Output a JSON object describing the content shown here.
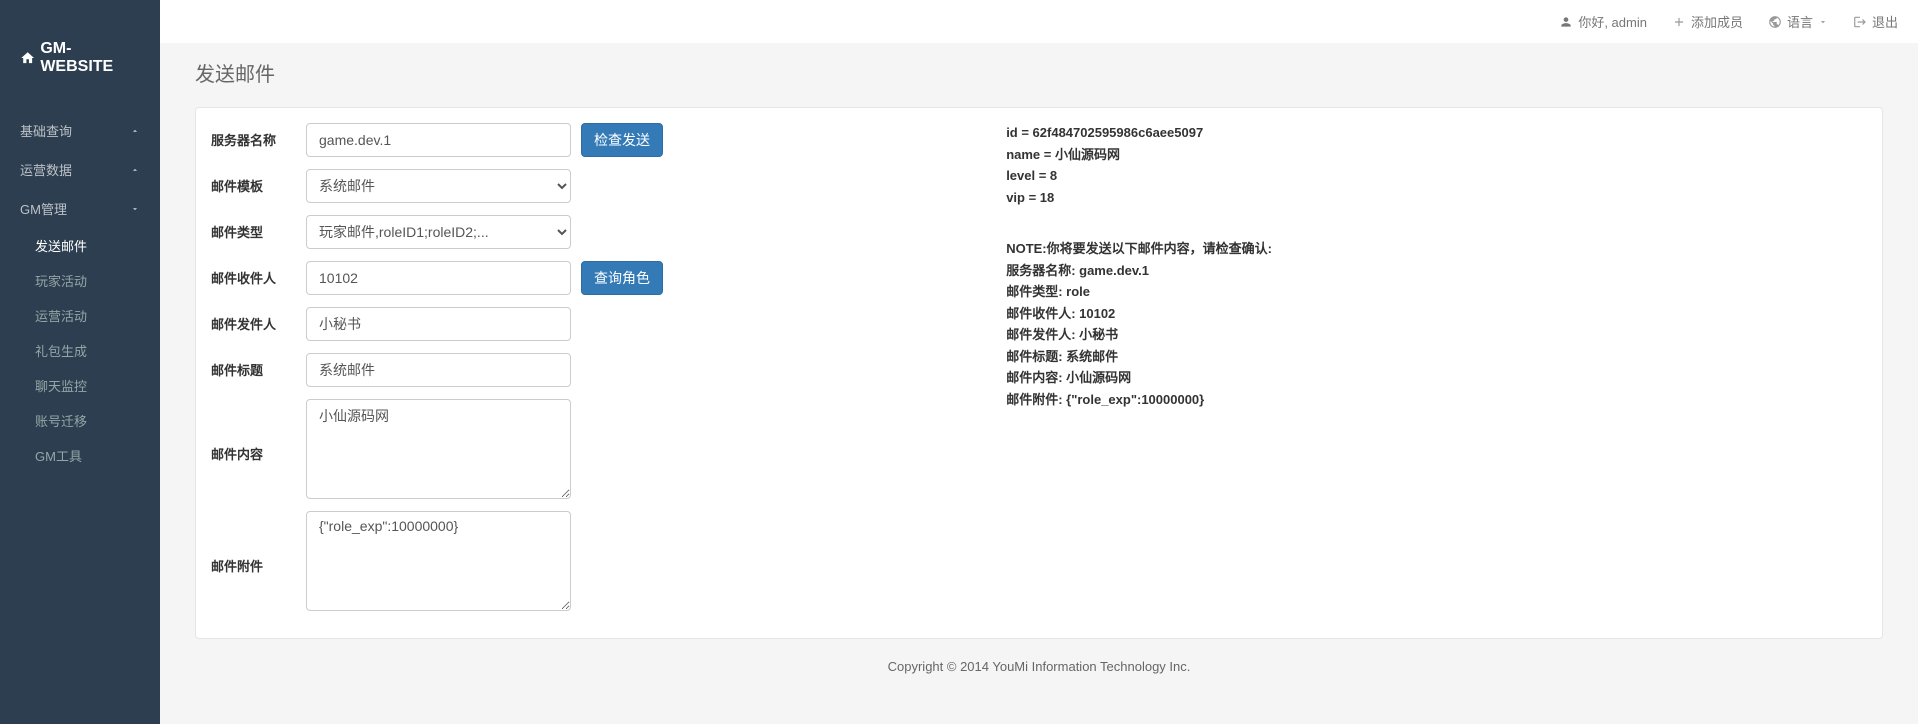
{
  "brand": "GM-WEBSITE",
  "topbar": {
    "greeting": "你好, admin",
    "add_member": "添加成员",
    "language": "语言",
    "logout": "退出"
  },
  "sidebar": {
    "items": [
      {
        "label": "基础查询"
      },
      {
        "label": "运营数据"
      },
      {
        "label": "GM管理"
      }
    ],
    "subitems": [
      {
        "label": "发送邮件",
        "active": true
      },
      {
        "label": "玩家活动",
        "active": false
      },
      {
        "label": "运营活动",
        "active": false
      },
      {
        "label": "礼包生成",
        "active": false
      },
      {
        "label": "聊天监控",
        "active": false
      },
      {
        "label": "账号迁移",
        "active": false
      },
      {
        "label": "GM工具",
        "active": false
      }
    ]
  },
  "page": {
    "title": "发送邮件"
  },
  "form": {
    "server_label": "服务器名称",
    "server_value": "game.dev.1",
    "check_send_btn": "检查发送",
    "template_label": "邮件模板",
    "template_value": "系统邮件",
    "type_label": "邮件类型",
    "type_value": "玩家邮件,roleID1;roleID2;...",
    "recipient_label": "邮件收件人",
    "recipient_value": "10102",
    "query_role_btn": "查询角色",
    "sender_label": "邮件发件人",
    "sender_value": "小秘书",
    "title_label": "邮件标题",
    "title_value": "系统邮件",
    "content_label": "邮件内容",
    "content_value": "小仙源码网",
    "attachment_label": "邮件附件",
    "attachment_value": "{\"role_exp\":10000000}"
  },
  "info": {
    "role": {
      "id": "id = 62f484702595986c6aee5097",
      "name": "name = 小仙源码网",
      "level": "level = 8",
      "vip": "vip = 18"
    },
    "note": "NOTE:你将要发送以下邮件内容，请检查确认:",
    "lines": [
      "服务器名称: game.dev.1",
      "邮件类型: role",
      "邮件收件人: 10102",
      "邮件发件人: 小秘书",
      "邮件标题: 系统邮件",
      "邮件内容: 小仙源码网",
      "邮件附件: {\"role_exp\":10000000}"
    ]
  },
  "footer": "Copyright © 2014 YouMi Information Technology Inc."
}
